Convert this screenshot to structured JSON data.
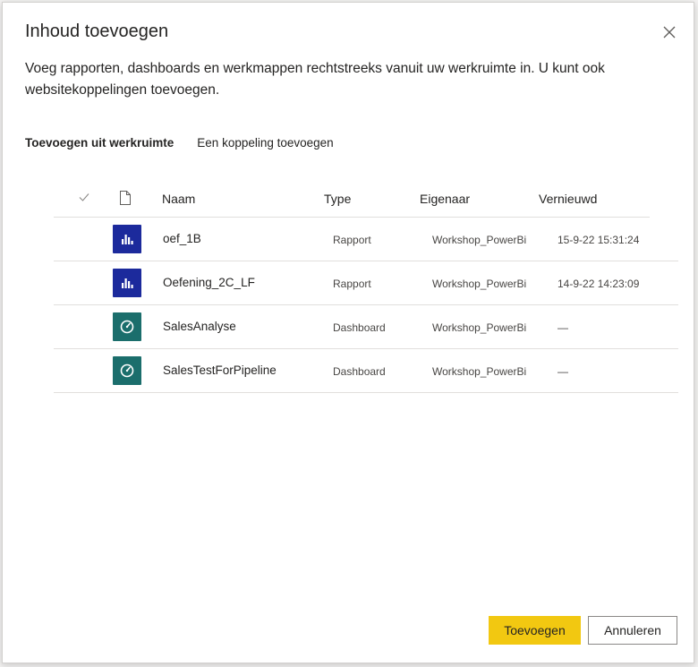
{
  "dialog": {
    "title": "Inhoud toevoegen",
    "description": "Voeg rapporten, dashboards en werkmappen rechtstreeks vanuit uw werkruimte in. U kunt ook websitekoppelingen toevoegen.",
    "close_icon": "close-icon"
  },
  "tabs": [
    {
      "label": "Toevoegen uit werkruimte",
      "active": true
    },
    {
      "label": "Een koppeling toevoegen",
      "active": false
    }
  ],
  "table": {
    "columns": {
      "check_icon": "checkmark-icon",
      "file_icon": "document-icon",
      "name": "Naam",
      "type": "Type",
      "owner": "Eigenaar",
      "refreshed": "Vernieuwd"
    },
    "rows": [
      {
        "icon": "report-icon",
        "name": "oef_1B",
        "type": "Rapport",
        "owner": "Workshop_PowerBi",
        "refreshed": "15-9-22 15:31:24"
      },
      {
        "icon": "report-icon",
        "name": "Oefening_2C_LF",
        "type": "Rapport",
        "owner": "Workshop_PowerBi",
        "refreshed": "14-9-22 14:23:09"
      },
      {
        "icon": "dashboard-icon",
        "name": "SalesAnalyse",
        "type": "Dashboard",
        "owner": "Workshop_PowerBi",
        "refreshed": "—"
      },
      {
        "icon": "dashboard-icon",
        "name": "SalesTestForPipeline",
        "type": "Dashboard",
        "owner": "Workshop_PowerBi",
        "refreshed": "—"
      }
    ]
  },
  "buttons": {
    "add": "Toevoegen",
    "cancel": "Annuleren"
  },
  "colors": {
    "primary": "#f2c811",
    "report_tile": "#1c2a9c",
    "dashboard_tile": "#1b6e6c"
  }
}
